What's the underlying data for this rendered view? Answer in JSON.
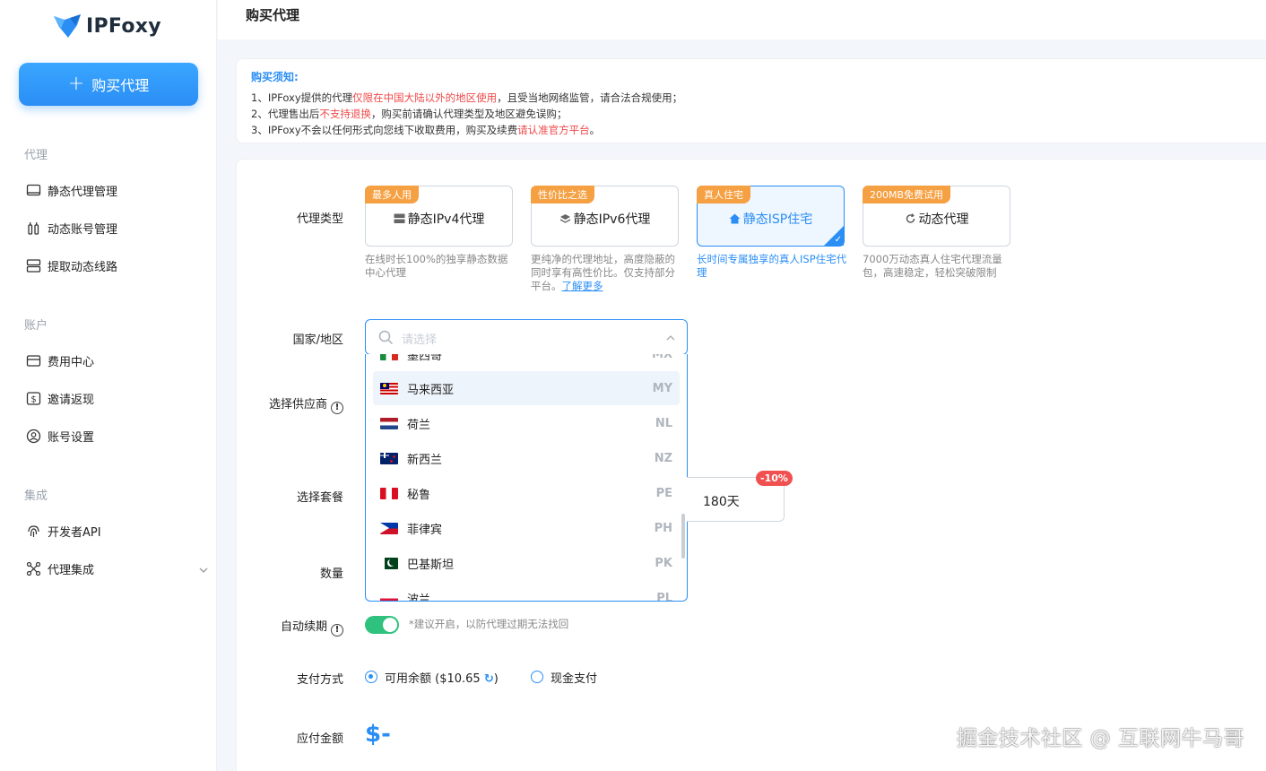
{
  "brand": {
    "name": "IPFoxy"
  },
  "sidebar": {
    "buy_button": "购买代理",
    "sections": [
      {
        "label": "代理",
        "items": [
          "静态代理管理",
          "动态账号管理",
          "提取动态线路"
        ]
      },
      {
        "label": "账户",
        "items": [
          "费用中心",
          "邀请返现",
          "账号设置"
        ]
      },
      {
        "label": "集成",
        "items": [
          "开发者API",
          "代理集成"
        ]
      }
    ]
  },
  "page": {
    "title": "购买代理"
  },
  "notice": {
    "title": "购买须知:",
    "line1_a": "1、IPFoxy提供的代理",
    "line1_red": "仅限在中国大陆以外的地区使用",
    "line1_b": "，且受当地网络监管，请合法合规使用；",
    "line2_a": "2、代理售出后",
    "line2_red": "不支持退换",
    "line2_b": "，购买前请确认代理类型及地区避免误购；",
    "line3_a": "3、IPFoxy不会以任何形式向您线下收取费用，购买及续费",
    "line3_red": "请认准官方平台",
    "line3_b": "。"
  },
  "form": {
    "proxy_type_label": "代理类型",
    "country_label": "国家/地区",
    "supplier_label": "选择供应商",
    "package_label": "选择套餐",
    "quantity_label": "数量",
    "auto_renew_label": "自动续期",
    "payment_label": "支付方式",
    "amount_label": "应付金额"
  },
  "proxy_types": [
    {
      "tag": "最多人用",
      "name": "静态IPv4代理",
      "desc": "在线时长100%的独享静态数据中心代理",
      "link": ""
    },
    {
      "tag": "性价比之选",
      "name": "静态IPv6代理",
      "desc": "更纯净的代理地址，高度隐蔽的同时享有高性价比。仅支持部分平台。",
      "link": "了解更多"
    },
    {
      "tag": "真人住宅",
      "name": "静态ISP住宅",
      "desc": "长时间专属独享的真人ISP住宅代理",
      "link": ""
    },
    {
      "tag": "200MB免费试用",
      "name": "动态代理",
      "desc": "7000万动态真人住宅代理流量包，高速稳定，轻松突破限制",
      "link": ""
    }
  ],
  "country_select": {
    "placeholder": "请选择",
    "options": [
      {
        "name": "墨西哥",
        "code": "MX"
      },
      {
        "name": "马来西亚",
        "code": "MY"
      },
      {
        "name": "荷兰",
        "code": "NL"
      },
      {
        "name": "新西兰",
        "code": "NZ"
      },
      {
        "name": "秘鲁",
        "code": "PE"
      },
      {
        "name": "菲律宾",
        "code": "PH"
      },
      {
        "name": "巴基斯坦",
        "code": "PK"
      },
      {
        "name": "波兰",
        "code": "PL"
      }
    ]
  },
  "package": {
    "label": "180天",
    "discount": "-10%"
  },
  "auto_renew": {
    "enabled": true,
    "note": "*建议开启，以防代理过期无法找回"
  },
  "payment": {
    "balance_label": "可用余额 ($10.65",
    "balance_close": ")",
    "cash_label": "现金支付",
    "selected": "balance"
  },
  "amount": {
    "value": "$-"
  },
  "watermark": "掘金技术社区 @ 互联网牛马哥",
  "colors": {
    "accent": "#2a8ef5",
    "tag": "#f5a042",
    "danger": "#f04848",
    "toggle": "#2ec27e"
  }
}
